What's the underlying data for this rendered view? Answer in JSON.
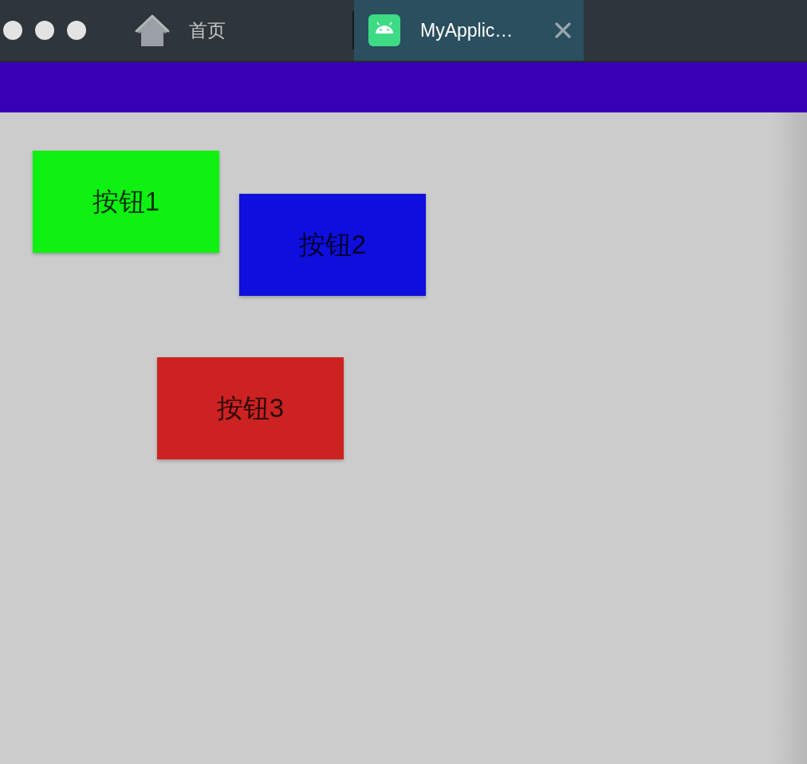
{
  "tabs": [
    {
      "kind": "home",
      "label": "首页",
      "selected": false
    },
    {
      "kind": "app",
      "label": "MyApplic…",
      "selected": true
    }
  ],
  "buttons": [
    {
      "label": "按钮1",
      "color": "#0ef111"
    },
    {
      "label": "按钮2",
      "color": "#0e0edd"
    },
    {
      "label": "按钮3",
      "color": "#cc2222"
    }
  ]
}
